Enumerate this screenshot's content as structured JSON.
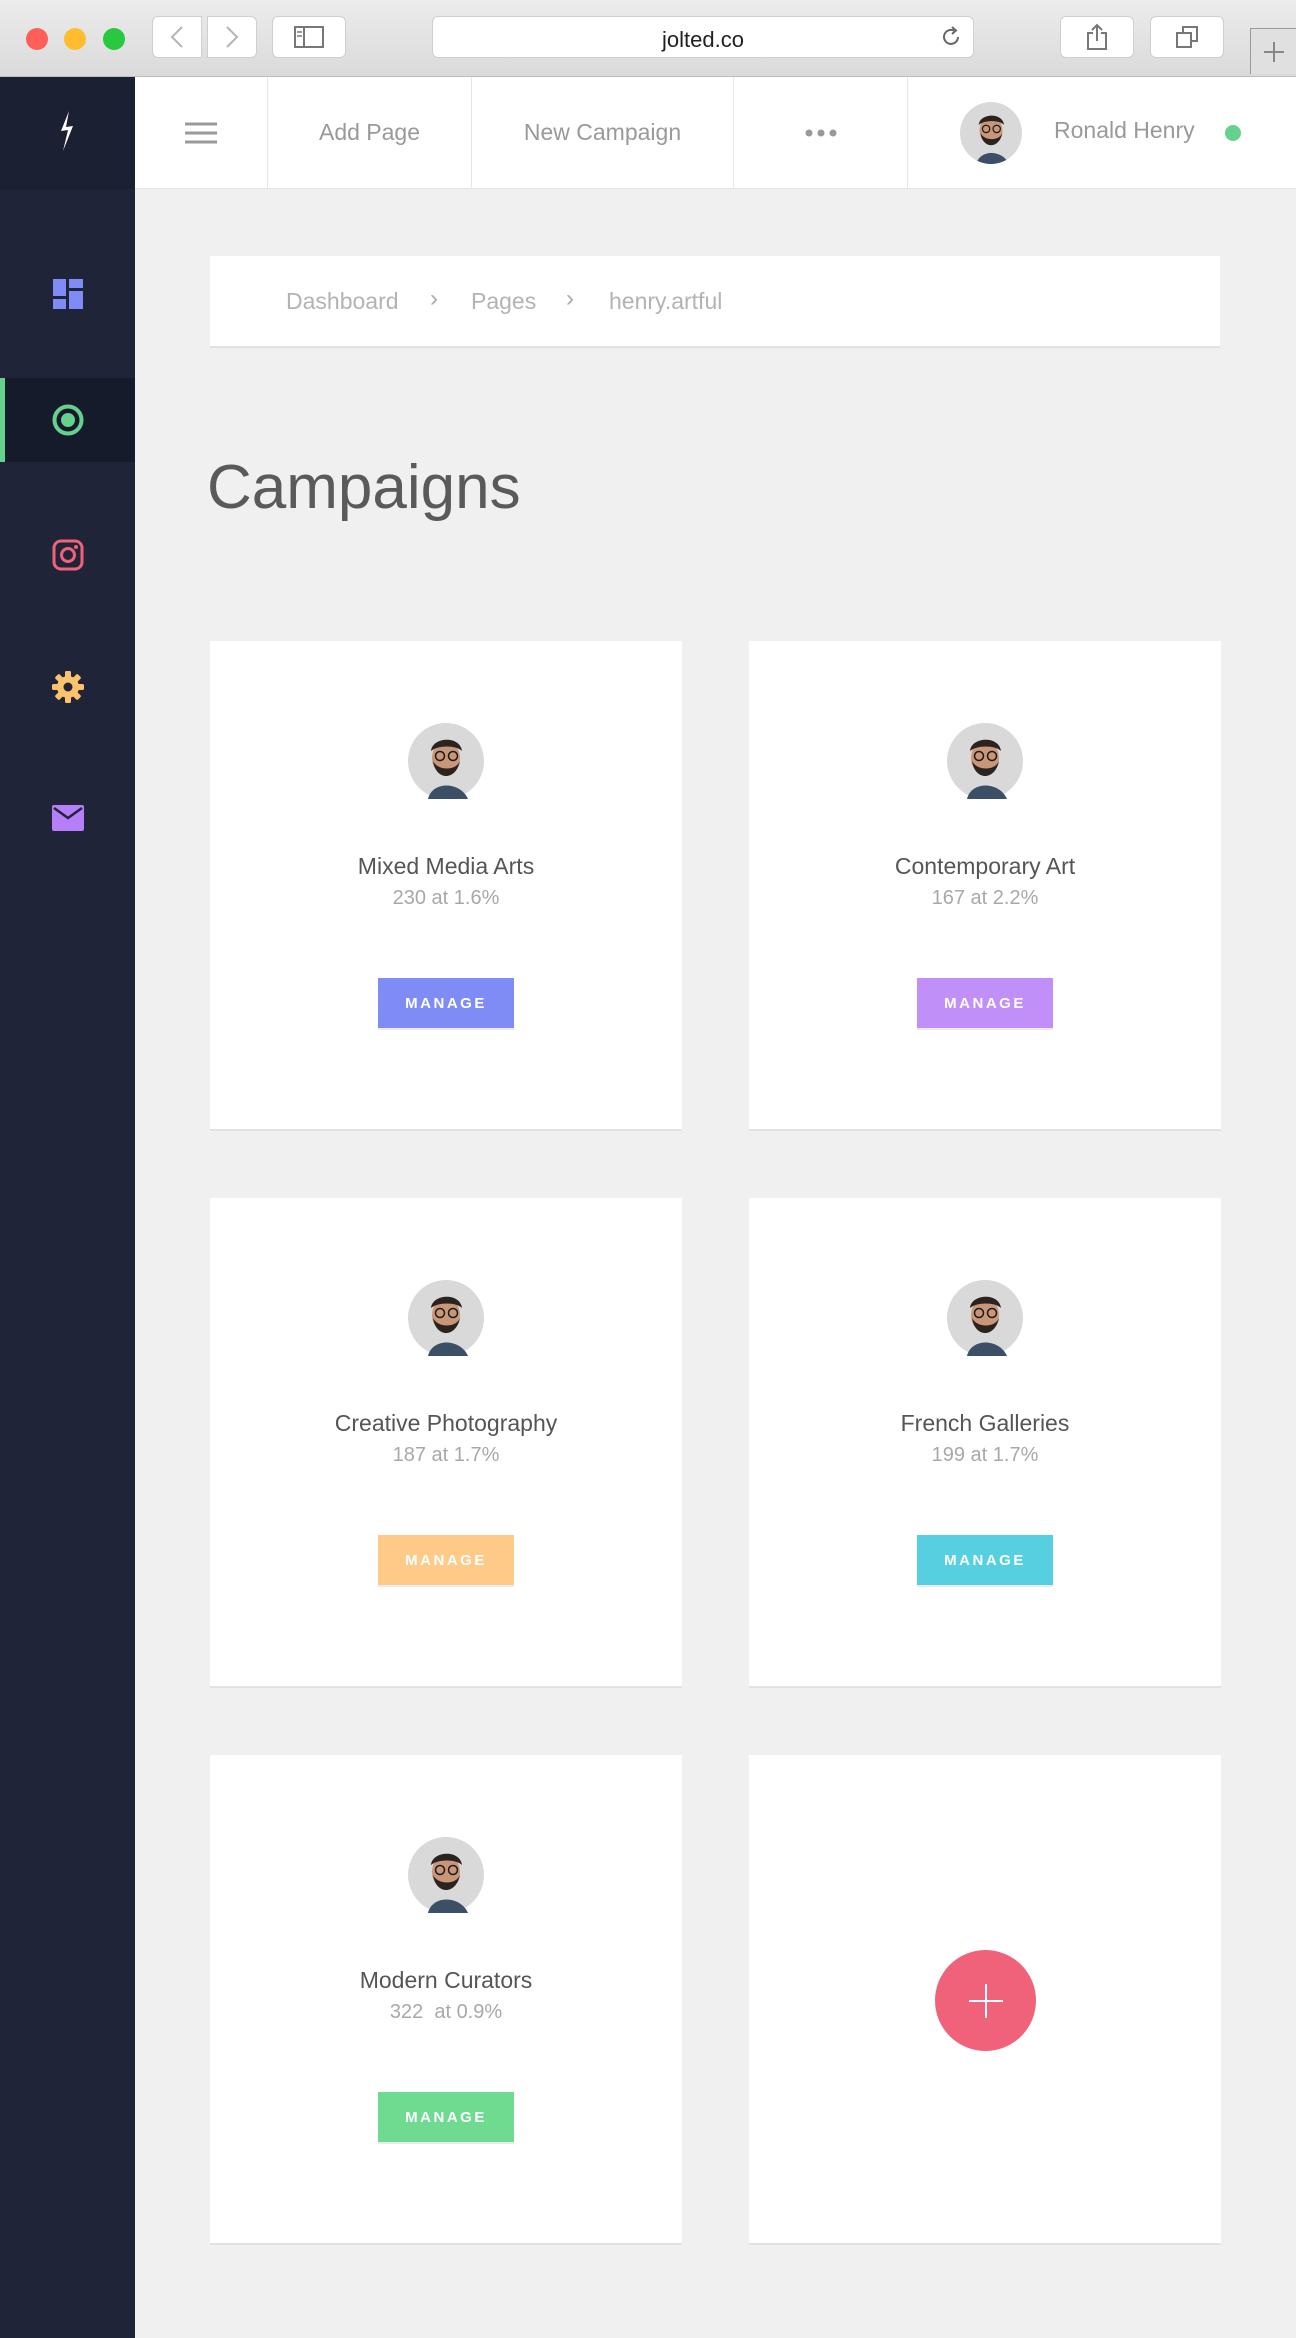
{
  "browser": {
    "url": "jolted.co"
  },
  "app": {
    "colors": {
      "accent_green": "#66d18d",
      "sidebar_bg": "#1f2438",
      "status_online": "#66d18d"
    },
    "sidebar": {
      "items": [
        {
          "icon": "dashboard-icon",
          "color": "#7f8cf5"
        },
        {
          "icon": "campaigns-target-icon",
          "color": "#66d18d",
          "active": true
        },
        {
          "icon": "instagram-icon",
          "color": "#f0627a"
        },
        {
          "icon": "settings-gear-icon",
          "color": "#fdc26e"
        },
        {
          "icon": "mail-icon",
          "color": "#b47ff9"
        }
      ]
    },
    "topbar": {
      "add_page": "Add Page",
      "new_campaign": "New Campaign",
      "more": "•••",
      "user_name": "Ronald Henry"
    }
  },
  "breadcrumb": [
    "Dashboard",
    "Pages",
    "henry.artful"
  ],
  "page_title": "Campaigns",
  "campaigns": [
    {
      "name": "Mixed Media Arts",
      "stats": "230 at 1.6%",
      "button": "MANAGE",
      "color": "#7f8cf5"
    },
    {
      "name": "Contemporary Art",
      "stats": "167 at 2.2%",
      "button": "MANAGE",
      "color": "#c08ff7"
    },
    {
      "name": "Creative Photography",
      "stats": "187 at 1.7%",
      "button": "MANAGE",
      "color": "#fdcb87"
    },
    {
      "name": "French Galleries",
      "stats": "199 at 1.7%",
      "button": "MANAGE",
      "color": "#56d0e0"
    },
    {
      "name": "Modern Curators",
      "stats": "322  at 0.9%",
      "button": "MANAGE",
      "color": "#6fdb91"
    }
  ],
  "add_button": {
    "icon": "plus-icon",
    "color": "#f0627a"
  }
}
